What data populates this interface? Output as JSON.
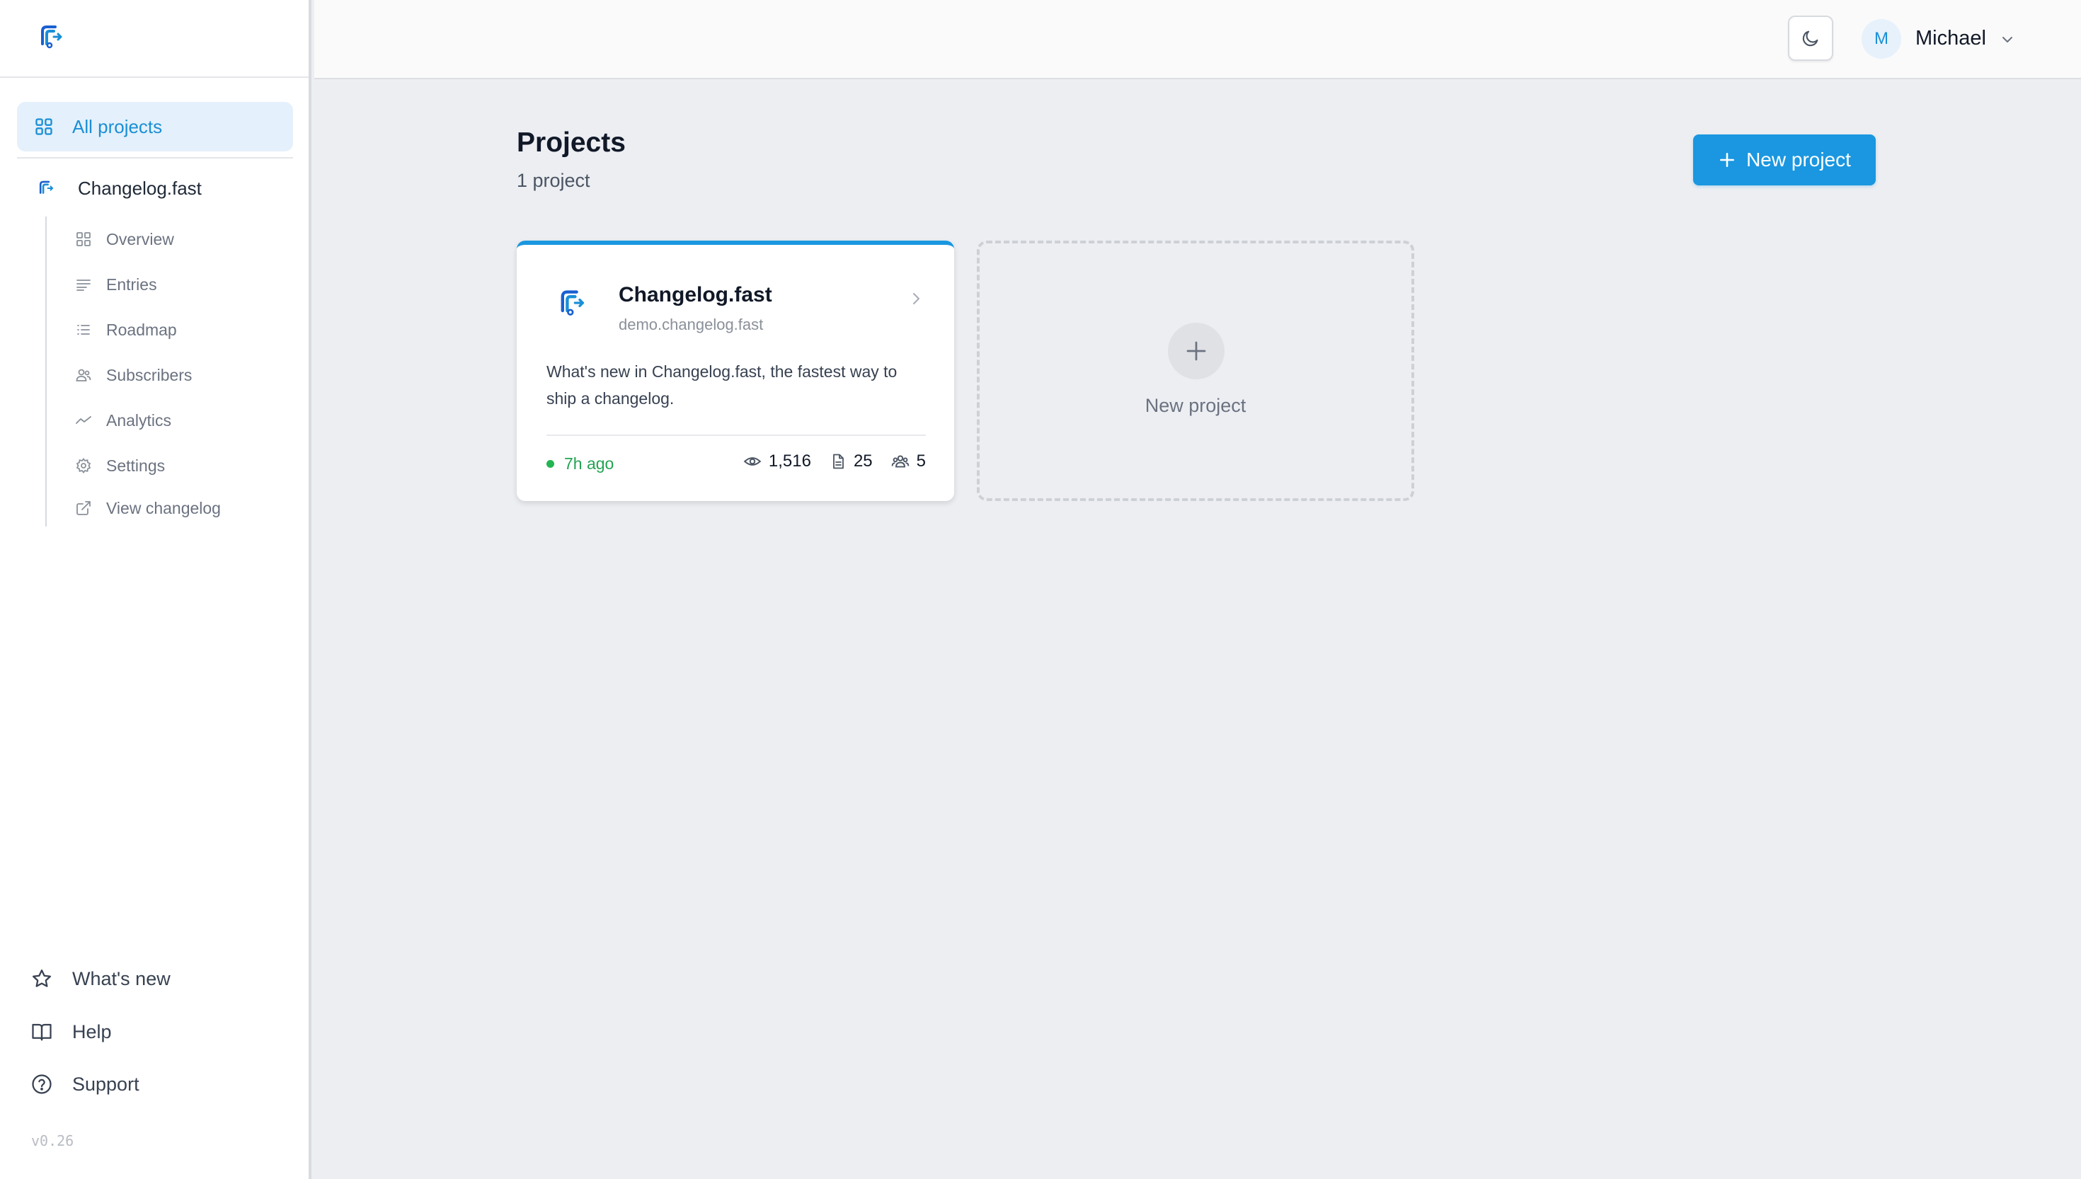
{
  "colors": {
    "accent": "#1a97e0",
    "accent_light": "#e4f0fb",
    "success": "#22a452",
    "sidebar_bg": "#ffffff",
    "main_bg": "#eceef2"
  },
  "sidebar": {
    "logo_icon": "changelog-logo-icon",
    "all_projects_label": "All projects",
    "project_name": "Changelog.fast",
    "subnav": [
      {
        "label": "Overview",
        "icon": "grid-icon"
      },
      {
        "label": "Entries",
        "icon": "lines-icon"
      },
      {
        "label": "Roadmap",
        "icon": "list-icon"
      },
      {
        "label": "Subscribers",
        "icon": "users-icon"
      },
      {
        "label": "Analytics",
        "icon": "trend-icon"
      },
      {
        "label": "Settings",
        "icon": "gear-icon"
      },
      {
        "label": "View changelog",
        "icon": "external-link-icon"
      }
    ],
    "bottom": [
      {
        "label": "What's new",
        "icon": "star-icon"
      },
      {
        "label": "Help",
        "icon": "book-icon"
      },
      {
        "label": "Support",
        "icon": "help-circle-icon"
      }
    ],
    "version": "v0.26"
  },
  "header": {
    "theme_icon": "moon-icon",
    "user_initial": "M",
    "user_name": "Michael"
  },
  "main": {
    "title": "Projects",
    "subtitle": "1 project",
    "new_project_label": "New project",
    "projects": [
      {
        "name": "Changelog.fast",
        "domain": "demo.changelog.fast",
        "description": "What's new in Changelog.fast, the fastest way to ship a changelog.",
        "updated": "7h ago",
        "views": "1,516",
        "entries": "25",
        "subscribers": "5"
      }
    ],
    "new_card_label": "New project"
  }
}
